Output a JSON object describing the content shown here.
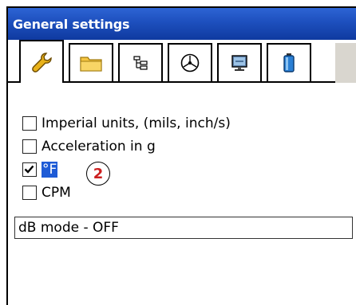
{
  "window": {
    "title": "General settings"
  },
  "tabs": [
    {
      "icon": "wrench-icon",
      "active": true
    },
    {
      "icon": "folder-icon",
      "active": false
    },
    {
      "icon": "tree-view-icon",
      "active": false
    },
    {
      "icon": "gauge-icon",
      "active": false
    },
    {
      "icon": "monitor-icon",
      "active": false
    },
    {
      "icon": "battery-icon",
      "active": false
    }
  ],
  "options": [
    {
      "label": "Imperial units, (mils, inch/s)",
      "checked": false
    },
    {
      "label": "Acceleration in g",
      "checked": false
    },
    {
      "label": "°F",
      "checked": true
    },
    {
      "label": "CPM",
      "checked": false
    }
  ],
  "annotation": {
    "badge": "2"
  },
  "db_mode": {
    "value": "dB mode - OFF"
  },
  "colors": {
    "titlebar": "#1d4fbd",
    "selection": "#1e5bd6",
    "badge_text": "#cc1f1f"
  }
}
